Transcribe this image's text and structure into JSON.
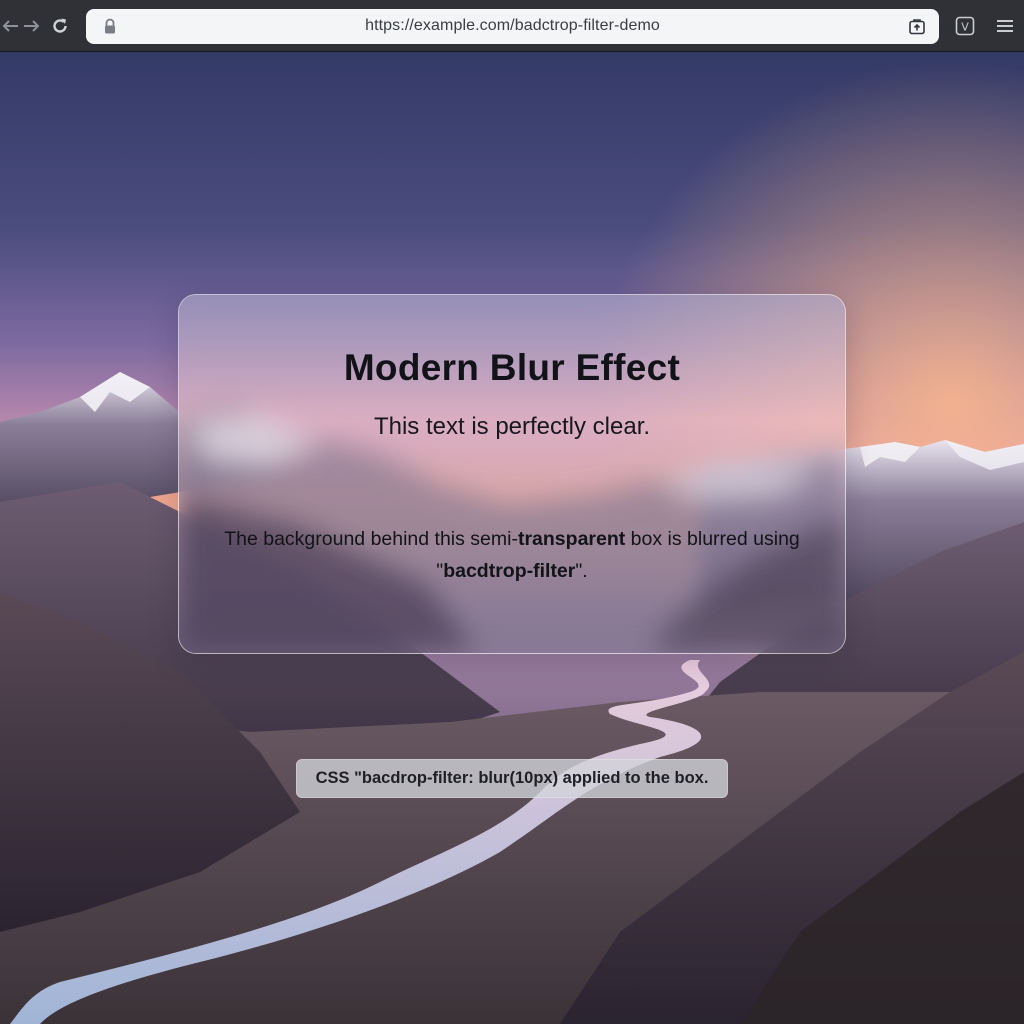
{
  "browser": {
    "url": "https://example.com/badctrop-filter-demo",
    "icons": {
      "back": "back-arrow-icon",
      "forward": "forward-arrow-icon",
      "reload": "reload-icon",
      "lock": "lock-icon",
      "tab": "tab-share-icon",
      "extension": "extension-v-icon",
      "menu": "hamburger-menu-icon"
    },
    "extension_letter": "V"
  },
  "card": {
    "title": "Modern Blur Effect",
    "subtitle": "This text is perfectly clear.",
    "body_part1": "The background behind this semi-",
    "body_bold1": "transparent",
    "body_part2": " box is blurred using \"",
    "body_bold2": "bacdtrop-filter",
    "body_part3": "\"."
  },
  "caption": {
    "text": "CSS \"bacdrop-filter: blur(10px) applied to the box."
  },
  "colors": {
    "sky_top": "#3c4270",
    "sky_mid": "#8a6aa0",
    "sunset_glow": "#f2a089",
    "mountain_dark": "#3e3446",
    "river": "#cfd6ee",
    "chrome_bg": "#2f3136",
    "urlbar_bg": "#f4f5f7"
  }
}
